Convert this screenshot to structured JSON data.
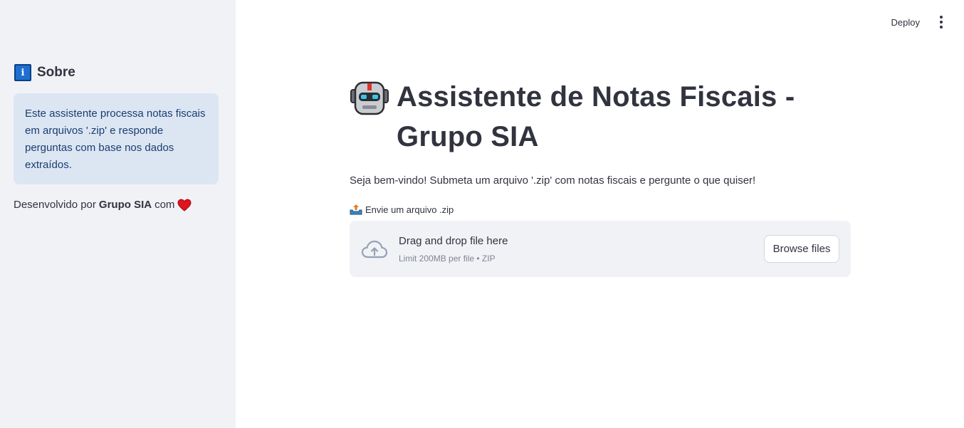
{
  "sidebar": {
    "heading": "Sobre",
    "info_text": "Este assistente processa notas fiscais em arquivos '.zip' e responde perguntas com base nos dados extraídos.",
    "credits_prefix": "Desenvolvido por",
    "credits_name": "Grupo SIA",
    "credits_suffix": "com",
    "heart_color": "#e0141e",
    "info_icon": "information-icon",
    "info_icon_glyph": "i"
  },
  "toolbar": {
    "deploy_label": "Deploy",
    "menu_icon": "kebab-menu-icon"
  },
  "main": {
    "title": "Assistente de Notas Fiscais - Grupo SIA",
    "title_icon": "robot-icon",
    "subtitle": "Seja bem-vindo! Submeta um arquivo '.zip' com notas fiscais e pergunte o que quiser!",
    "uploader": {
      "label": "Envie um arquivo .zip",
      "label_icon": "outbox-tray-icon",
      "dropzone_title": "Drag and drop file here",
      "dropzone_limit": "Limit 200MB per file • ZIP",
      "browse_label": "Browse files",
      "cloud_icon": "cloud-upload-icon"
    }
  },
  "colors": {
    "sidebar_bg": "#f0f2f6",
    "info_box_bg": "#dce6f3",
    "info_text": "#1b3d6f",
    "text": "#31333f",
    "muted": "#808495"
  }
}
